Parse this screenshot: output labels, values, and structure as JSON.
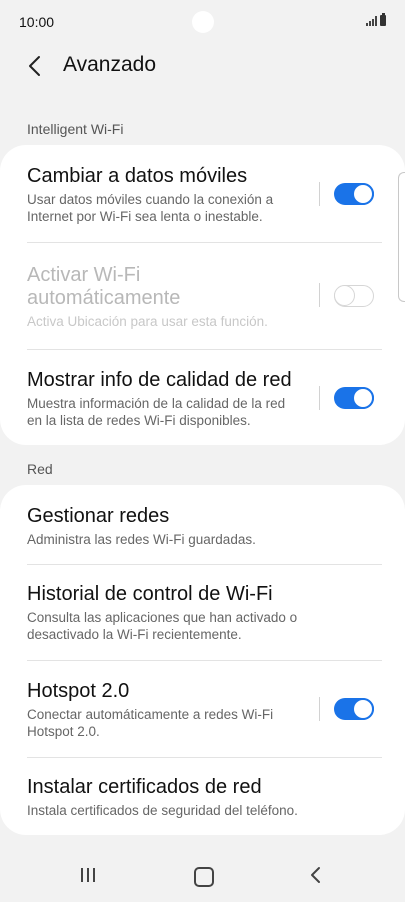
{
  "status_bar": {
    "time": "10:00",
    "icons": [
      "signal-icon",
      "battery-icon"
    ]
  },
  "header": {
    "back_icon": "chevron-left-icon",
    "title": "Avanzado"
  },
  "sections": [
    {
      "label": "Intelligent Wi-Fi",
      "items": [
        {
          "title": "Cambiar a datos móviles",
          "subtitle": "Usar datos móviles cuando la conexión a Internet por Wi-Fi sea lenta o inestable.",
          "toggle": true,
          "enabled": true
        },
        {
          "title": "Activar Wi-Fi automáticamente",
          "subtitle": "Activa Ubicación para usar esta función.",
          "toggle": false,
          "enabled": false
        },
        {
          "title": "Mostrar info de calidad de red",
          "subtitle": "Muestra información de la calidad de la red en la lista de redes Wi-Fi disponibles.",
          "toggle": true,
          "enabled": true
        }
      ]
    },
    {
      "label": "Red",
      "items": [
        {
          "title": "Gestionar redes",
          "subtitle": "Administra las redes Wi-Fi guardadas."
        },
        {
          "title": "Historial de control de Wi-Fi",
          "subtitle": "Consulta las aplicaciones que han activado o desactivado la Wi-Fi recientemente."
        },
        {
          "title": "Hotspot 2.0",
          "subtitle": "Conectar automáticamente a redes Wi-Fi Hotspot 2.0.",
          "toggle": true,
          "enabled": true
        },
        {
          "title": "Instalar certificados de red",
          "subtitle": "Instala certificados de seguridad del teléfono."
        }
      ]
    }
  ],
  "nav_bar": {
    "icons": [
      "recent-apps-icon",
      "home-icon",
      "back-icon"
    ]
  },
  "colors": {
    "accent": "#1a73e8",
    "background": "#f2f2f2",
    "card": "#ffffff"
  }
}
